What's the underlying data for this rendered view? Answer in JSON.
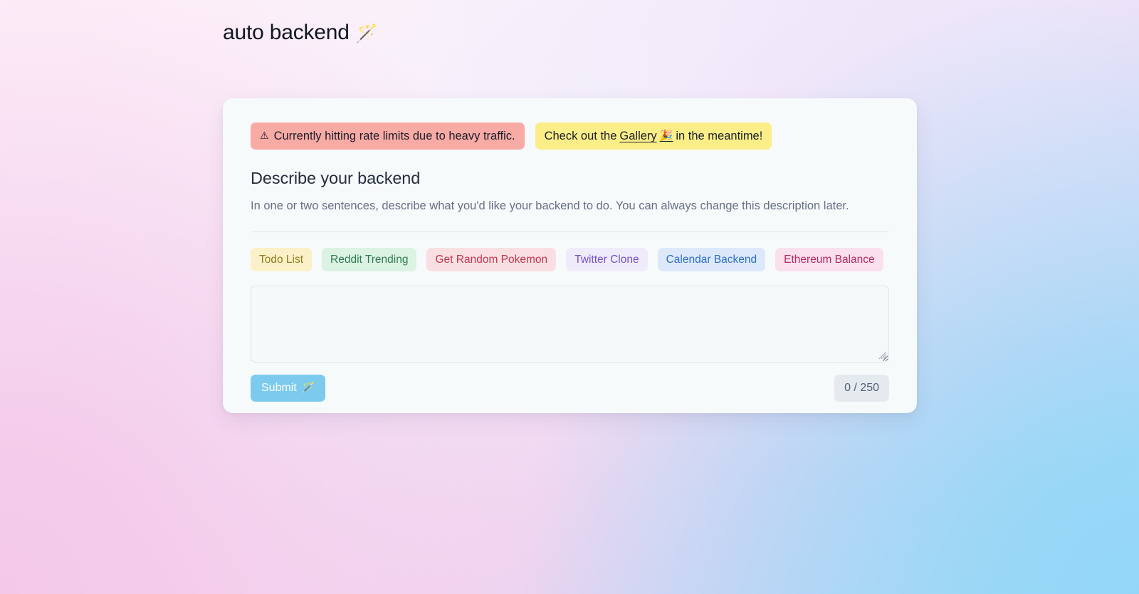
{
  "brand": {
    "name": "auto backend",
    "icon": "magic-wand-emoji",
    "icon_glyph": "🪄"
  },
  "banners": {
    "warning": {
      "icon": "warning-triangle-icon",
      "icon_glyph": "⚠",
      "text": "Currently hitting rate limits due to heavy traffic.",
      "bg_color": "#f8aaa5",
      "text_color": "#1b1f2a"
    },
    "info": {
      "prefix": "Check out the",
      "link_label": "Gallery",
      "link_icon": "party-popper-emoji",
      "link_icon_glyph": "🎉",
      "suffix": "in the meantime!",
      "bg_color": "#fbee88",
      "text_color": "#1b1f2a"
    }
  },
  "form": {
    "title": "Describe your backend",
    "description": "In one or two sentences, describe what you'd like your backend to do. You can always change this description later.",
    "textarea": {
      "value": "",
      "placeholder": ""
    },
    "submit": {
      "label": "Submit",
      "icon": "magic-wand-emoji",
      "icon_glyph": "🪄",
      "bg_color": "#7ccbee"
    },
    "counter": {
      "text": "0 / 250",
      "current": 0,
      "max": 250
    }
  },
  "examples": [
    {
      "label": "Todo List",
      "bg_color": "#faf1c8",
      "text_color": "#927b1f"
    },
    {
      "label": "Reddit Trending",
      "bg_color": "#dcf3e4",
      "text_color": "#2f7a4e"
    },
    {
      "label": "Get Random Pokemon",
      "bg_color": "#fadfe2",
      "text_color": "#c0374f"
    },
    {
      "label": "Twitter Clone",
      "bg_color": "#f0ebfb",
      "text_color": "#7054c8"
    },
    {
      "label": "Calendar Backend",
      "bg_color": "#dde9fb",
      "text_color": "#2d6fc4"
    },
    {
      "label": "Ethereum Balance",
      "bg_color": "#fae0ec",
      "text_color": "#b62b62"
    }
  ]
}
